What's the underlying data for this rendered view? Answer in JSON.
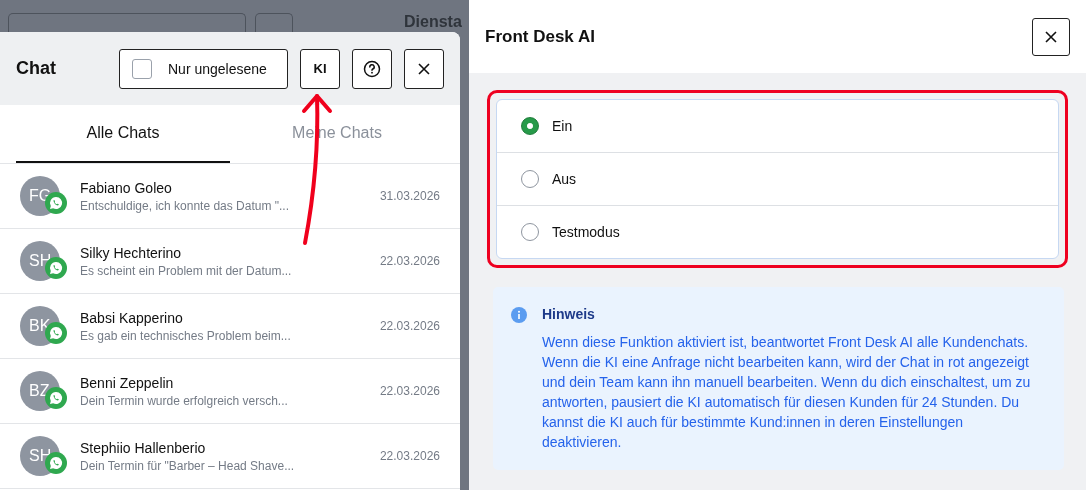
{
  "background": {
    "heading": "Diensta"
  },
  "chat": {
    "title": "Chat",
    "unread_filter": {
      "label": "Nur ungelesene",
      "checked": false
    },
    "ai_button": "KI",
    "tabs": [
      {
        "label": "Alle Chats",
        "selected": true
      },
      {
        "label": "Meine Chats",
        "selected": false
      }
    ],
    "conversations": [
      {
        "initials": "FG",
        "name": "Fabiano Goleo",
        "preview": "Entschuldige, ich konnte das Datum \"...",
        "date": "31.03.2026"
      },
      {
        "initials": "SH",
        "name": "Silky Hechterino",
        "preview": "Es scheint ein Problem mit der Datum...",
        "date": "22.03.2026"
      },
      {
        "initials": "BK",
        "name": "Babsi Kapperino",
        "preview": "Es gab ein technisches Problem beim...",
        "date": "22.03.2026"
      },
      {
        "initials": "BZ",
        "name": "Benni Zeppelin",
        "preview": "Dein Termin wurde erfolgreich versch...",
        "date": "22.03.2026"
      },
      {
        "initials": "SH",
        "name": "Stephiio Hallenberio",
        "preview": "Dein Termin für \"Barber – Head Shave...",
        "date": "22.03.2026"
      }
    ]
  },
  "front_desk": {
    "title": "Front Desk AI",
    "options": [
      {
        "label": "Ein",
        "selected": true
      },
      {
        "label": "Aus",
        "selected": false
      },
      {
        "label": "Testmodus",
        "selected": false
      }
    ],
    "notice": {
      "title": "Hinweis",
      "text": "Wenn diese Funktion aktiviert ist, beantwortet Front Desk AI alle Kundenchats. Wenn die KI eine Anfrage nicht bearbeiten kann, wird der Chat in rot angezeigt und dein Team kann ihn manuell bearbeiten. Wenn du dich einschaltest, um zu antworten, pausiert die KI automatisch für diesen Kunden für 24 Stunden. Du kannst die KI auch für bestimmte Kund:innen in deren Einstellungen deaktivieren."
    }
  }
}
